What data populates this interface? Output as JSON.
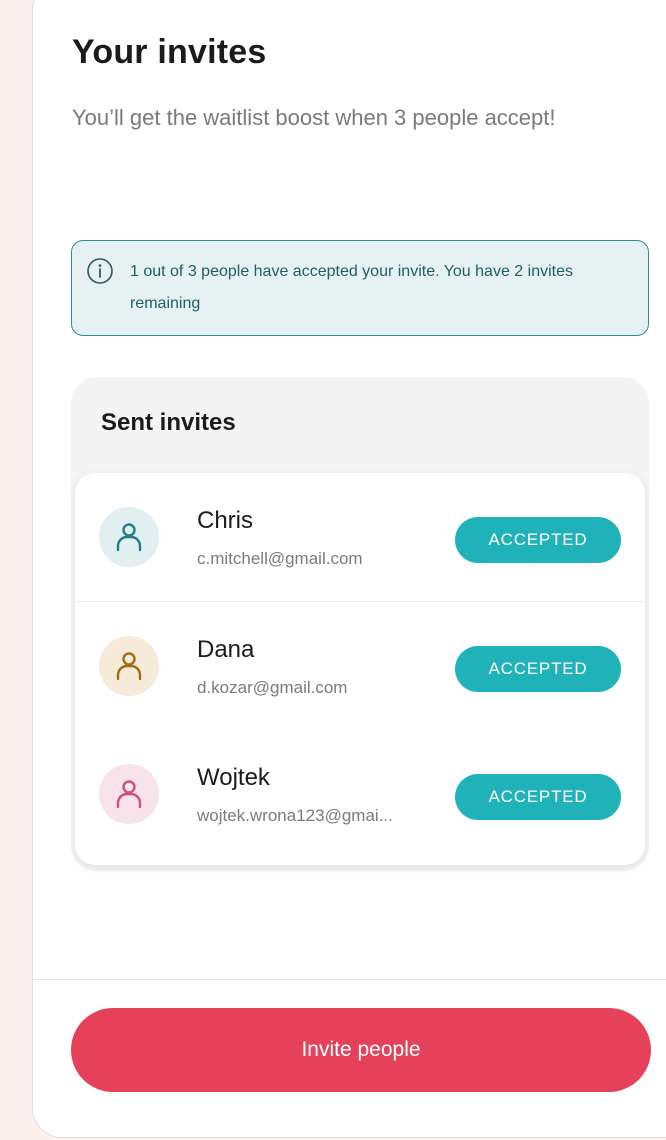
{
  "page": {
    "title": "Your invites",
    "subtitle": "You’ll get the waitlist boost when 3 people accept!"
  },
  "info": {
    "icon": "info-icon",
    "message": "1 out of 3 people have accepted your invite. You have 2 invites remaining"
  },
  "sent_invites": {
    "heading": "Sent invites",
    "items": [
      {
        "name": "Chris",
        "email": "c.mitchell@gmail.com",
        "status": "ACCEPTED",
        "avatar_icon": "person-icon",
        "avatar_bg": "#e2eff1",
        "avatar_fg": "#1f7f85"
      },
      {
        "name": "Dana",
        "email": "d.kozar@gmail.com",
        "status": "ACCEPTED",
        "avatar_icon": "person-icon",
        "avatar_bg": "#f6ead9",
        "avatar_fg": "#a36c12"
      },
      {
        "name": "Wojtek",
        "email": "wojtek.wrona123@gmai...",
        "status": "ACCEPTED",
        "avatar_icon": "person-icon",
        "avatar_bg": "#f8e3ea",
        "avatar_fg": "#cd4f80"
      }
    ]
  },
  "actions": {
    "invite_button": "Invite people"
  },
  "colors": {
    "accent": "#1fb2b9",
    "primary_button": "#e6415a",
    "info_border": "#3a8a8e",
    "info_bg": "#e6f1f1",
    "page_bg": "#fbf2ee"
  }
}
